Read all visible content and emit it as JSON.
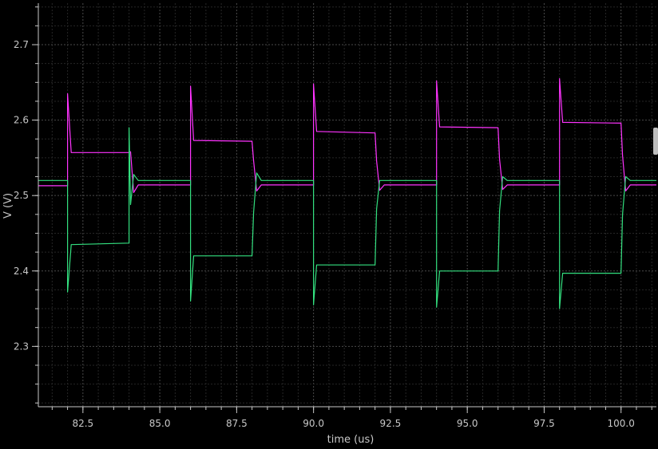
{
  "chart_data": {
    "type": "line",
    "xlabel": "time (us)",
    "ylabel": "V (V)",
    "xlim": [
      81.05,
      101.15
    ],
    "ylim": [
      2.22,
      2.755
    ],
    "x_ticks": [
      "82.5",
      "85.0",
      "87.5",
      "90.0",
      "92.5",
      "95.0",
      "97.5",
      "100.0"
    ],
    "y_ticks": [
      "2.3",
      "2.4",
      "2.5",
      "2.6",
      "2.7"
    ],
    "grid": true,
    "background": "#000000",
    "series": [
      {
        "color": "#ff33ff",
        "x": [
          81.05,
          82.0,
          82.0,
          82.12,
          84.0,
          84.05,
          84.15,
          84.3,
          86.0,
          86.0,
          86.1,
          88.0,
          88.05,
          88.15,
          88.3,
          90.0,
          90.0,
          90.1,
          92.0,
          92.05,
          92.15,
          92.3,
          94.0,
          94.0,
          94.1,
          96.0,
          96.05,
          96.15,
          96.3,
          98.0,
          98.0,
          98.1,
          100.0,
          100.05,
          100.15,
          100.3,
          101.15
        ],
        "y": [
          2.513,
          2.513,
          2.635,
          2.557,
          2.557,
          2.558,
          2.504,
          2.514,
          2.514,
          2.645,
          2.573,
          2.572,
          2.546,
          2.506,
          2.514,
          2.514,
          2.648,
          2.585,
          2.583,
          2.546,
          2.507,
          2.514,
          2.514,
          2.652,
          2.591,
          2.59,
          2.548,
          2.508,
          2.514,
          2.514,
          2.655,
          2.597,
          2.596,
          2.553,
          2.506,
          2.514,
          2.514
        ]
      },
      {
        "color": "#33e07f",
        "x": [
          81.05,
          82.0,
          82.0,
          82.12,
          84.0,
          84.0,
          84.05,
          84.15,
          84.3,
          86.0,
          86.0,
          86.1,
          88.0,
          88.05,
          88.15,
          88.3,
          90.0,
          90.0,
          90.1,
          92.0,
          92.05,
          92.15,
          92.3,
          94.0,
          94.0,
          94.1,
          96.0,
          96.05,
          96.15,
          96.3,
          98.0,
          98.0,
          98.1,
          100.0,
          100.05,
          100.15,
          100.3,
          101.15
        ],
        "y": [
          2.52,
          2.52,
          2.372,
          2.435,
          2.437,
          2.59,
          2.488,
          2.528,
          2.52,
          2.52,
          2.36,
          2.42,
          2.42,
          2.478,
          2.53,
          2.52,
          2.52,
          2.355,
          2.408,
          2.408,
          2.482,
          2.52,
          2.52,
          2.52,
          2.352,
          2.4,
          2.4,
          2.48,
          2.525,
          2.52,
          2.52,
          2.35,
          2.397,
          2.397,
          2.475,
          2.525,
          2.52,
          2.52
        ]
      }
    ]
  }
}
